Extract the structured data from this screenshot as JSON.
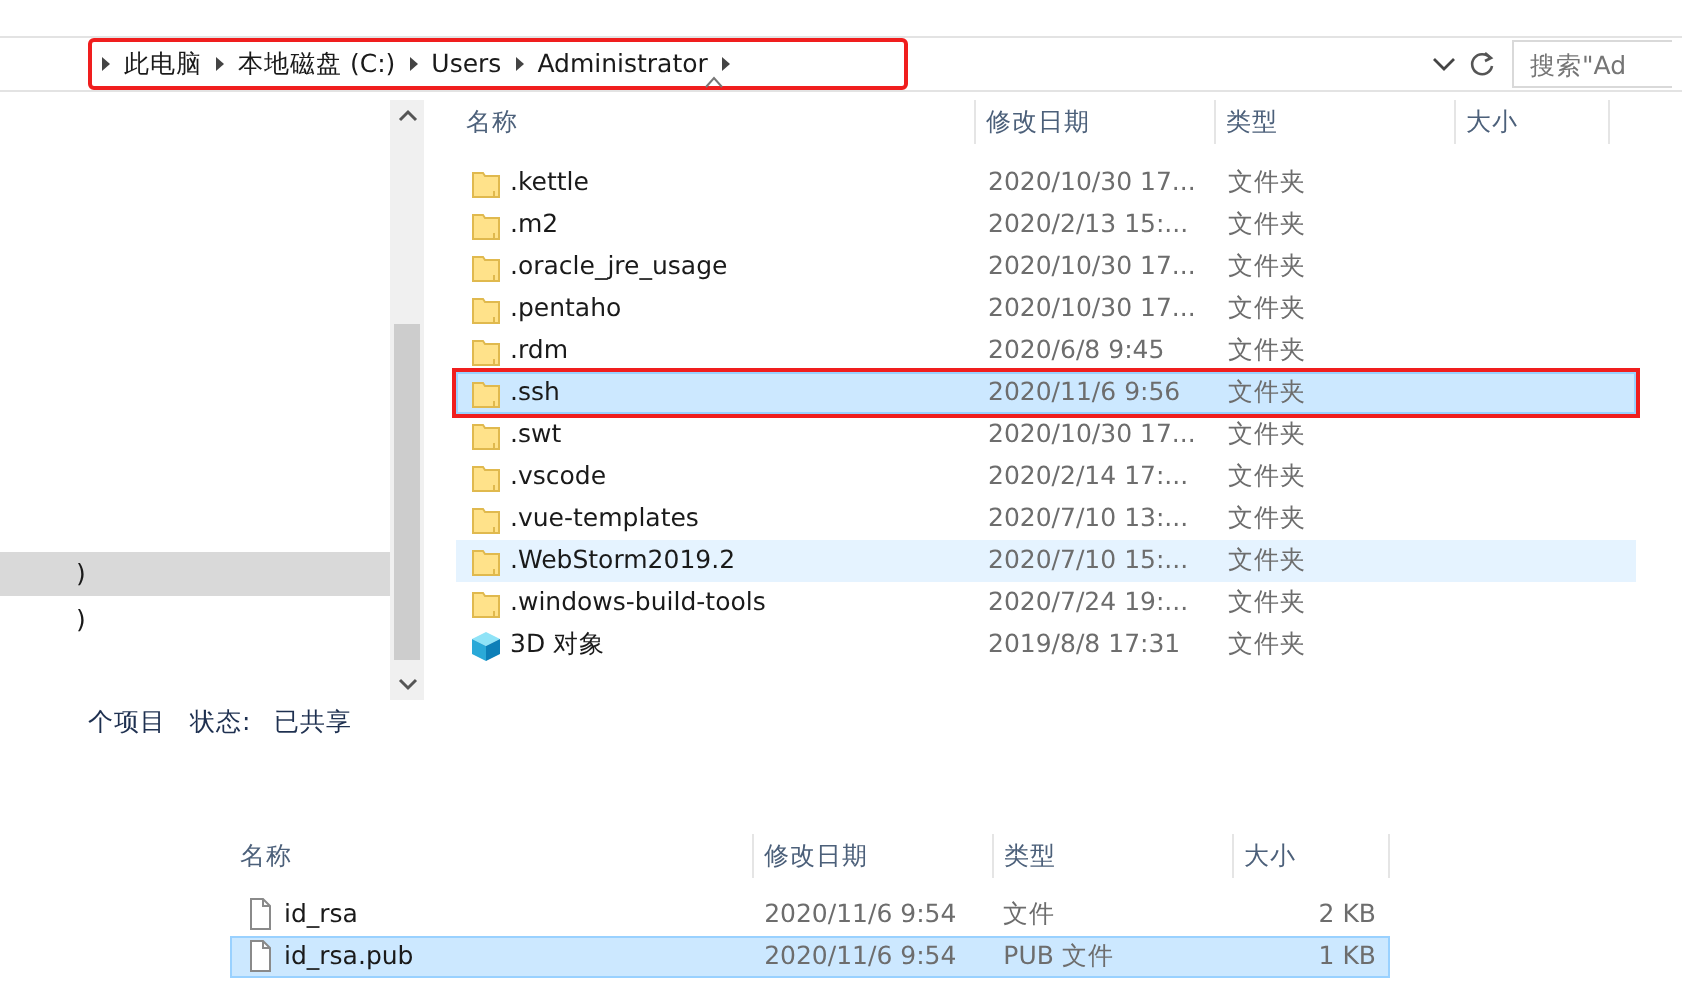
{
  "address_bar": {
    "annotated": true,
    "crumbs": [
      "此电脑",
      "本地磁盘 (C:)",
      "Users",
      "Administrator"
    ],
    "search_placeholder": "搜索\"Ad"
  },
  "top_pane": {
    "nav_items": [
      {
        "label": ")",
        "selected": true
      },
      {
        "label": ")",
        "selected": false
      }
    ],
    "columns": [
      "名称",
      "修改日期",
      "类型",
      "大小"
    ],
    "rows": [
      {
        "kind": "folder",
        "name": ".kettle",
        "date": "2020/10/30 17...",
        "type": "文件夹",
        "selected": false,
        "hovered": false,
        "annotated": false
      },
      {
        "kind": "folder",
        "name": ".m2",
        "date": "2020/2/13 15:...",
        "type": "文件夹",
        "selected": false,
        "hovered": false,
        "annotated": false
      },
      {
        "kind": "folder",
        "name": ".oracle_jre_usage",
        "date": "2020/10/30 17...",
        "type": "文件夹",
        "selected": false,
        "hovered": false,
        "annotated": false
      },
      {
        "kind": "folder",
        "name": ".pentaho",
        "date": "2020/10/30 17...",
        "type": "文件夹",
        "selected": false,
        "hovered": false,
        "annotated": false
      },
      {
        "kind": "folder",
        "name": ".rdm",
        "date": "2020/6/8 9:45",
        "type": "文件夹",
        "selected": false,
        "hovered": false,
        "annotated": false
      },
      {
        "kind": "folder",
        "name": ".ssh",
        "date": "2020/11/6 9:56",
        "type": "文件夹",
        "selected": true,
        "hovered": false,
        "annotated": true
      },
      {
        "kind": "folder",
        "name": ".swt",
        "date": "2020/10/30 17...",
        "type": "文件夹",
        "selected": false,
        "hovered": false,
        "annotated": false
      },
      {
        "kind": "folder",
        "name": ".vscode",
        "date": "2020/2/14 17:...",
        "type": "文件夹",
        "selected": false,
        "hovered": false,
        "annotated": false
      },
      {
        "kind": "folder",
        "name": ".vue-templates",
        "date": "2020/7/10 13:...",
        "type": "文件夹",
        "selected": false,
        "hovered": false,
        "annotated": false
      },
      {
        "kind": "folder",
        "name": ".WebStorm2019.2",
        "date": "2020/7/10 15:...",
        "type": "文件夹",
        "selected": false,
        "hovered": true,
        "annotated": false
      },
      {
        "kind": "folder",
        "name": ".windows-build-tools",
        "date": "2020/7/24 19:...",
        "type": "文件夹",
        "selected": false,
        "hovered": false,
        "annotated": false
      },
      {
        "kind": "cube",
        "name": "3D 对象",
        "date": "2019/8/8 17:31",
        "type": "文件夹",
        "selected": false,
        "hovered": false,
        "annotated": false
      }
    ],
    "status": [
      "个项目",
      "状态:",
      "已共享"
    ]
  },
  "bottom_pane": {
    "columns": [
      "名称",
      "修改日期",
      "类型",
      "大小"
    ],
    "rows": [
      {
        "kind": "file",
        "name": "id_rsa",
        "date": "2020/11/6 9:54",
        "type": "文件",
        "size": "2 KB",
        "selected": false
      },
      {
        "kind": "file",
        "name": "id_rsa.pub",
        "date": "2020/11/6 9:54",
        "type": "PUB 文件",
        "size": "1 KB",
        "selected": true
      }
    ]
  }
}
